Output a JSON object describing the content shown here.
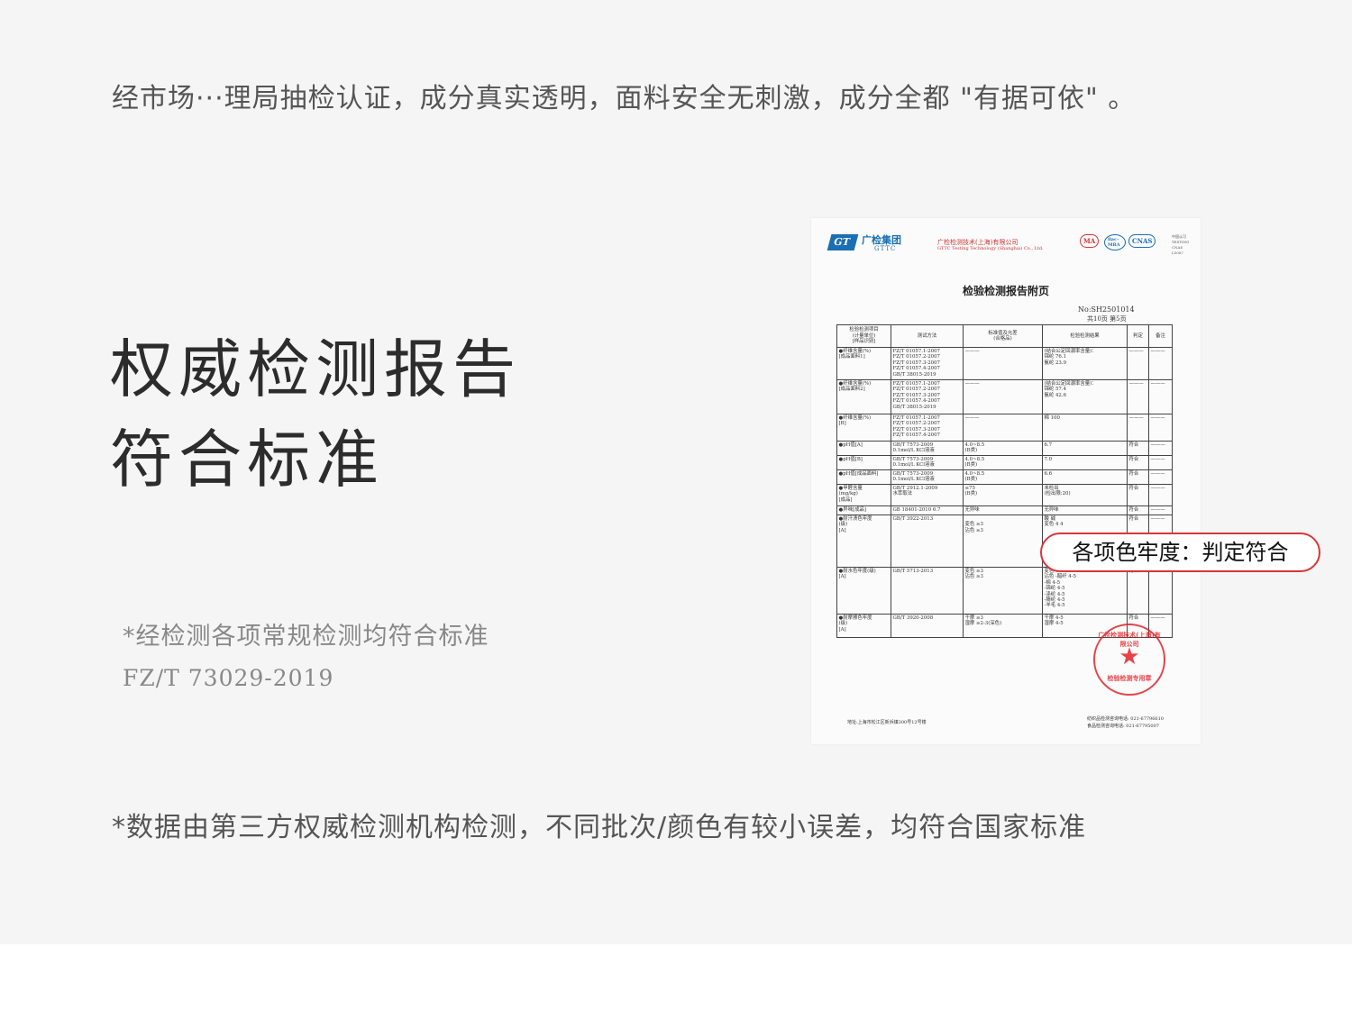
{
  "top_text": "经市场···理局抽检认证，成分真实透明，面料安全无刺激，成分全都 \"有据可依\" 。",
  "headline": {
    "line1": "权威检测报告",
    "line2": "符合标准"
  },
  "note1": "*经检测各项常规检测均符合标准",
  "note2": "FZ/T  73029-2019",
  "bottom_text": "*数据由第三方权威检测机构检测，不同批次/颜色有较小误差，均符合国家标准",
  "callout": "各项色牢度：判定符合",
  "report": {
    "group_name": "广检集团",
    "group_sub": "GTTC",
    "company": "广检检测技术(上海)有限公司",
    "company_en": "GTTC Testing Technology (Shanghai) Co., Ltd.",
    "cert_ma": "MA",
    "cert_ilac": "ilac-MRA",
    "cert_cnas": "CNAS",
    "cert_small": "中国认可\nTESTING\nCNAS L5007",
    "title": "检验检测报告附页",
    "report_no": "No:SH2501014",
    "page_info": "共10页  第5页",
    "headers": [
      "检验检测项目\n(计量单位)\n[样品识别]",
      "测试方法",
      "标准值及允差\n(合格品)",
      "检验检测结果",
      "判定",
      "备注"
    ],
    "rows": [
      [
        "●纤维含量(%)\n[成品面料1]",
        "FZ/T 01057.1-2007\nFZ/T 01057.2-2007\nFZ/T 01057.3-2007\nFZ/T 01057.4-2007\nGB/T 38015-2019",
        "———",
        "(结合公定回潮率含量)：\n锦纶        76.1\n氨纶        23.9",
        "———",
        "———"
      ],
      [
        "●纤维含量(%)\n[成品面料2]",
        "FZ/T 01057.1-2007\nFZ/T 01057.2-2007\nFZ/T 01057.3-2007\nFZ/T 01057.4-2007\nGB/T 38015-2019",
        "———",
        "(结合公定回潮率含量)：\n锦纶        57.4\n氨纶        42.6",
        "———",
        "———"
      ],
      [
        "●纤维含量(%)\n[B]",
        "FZ/T 01057.1-2007\nFZ/T 01057.2-2007\nFZ/T 01057.3-2007\nFZ/T 01057.4-2007",
        "———",
        "棉          100",
        "———",
        "———"
      ],
      [
        "●pH值[A]",
        "GB/T 7573-2009\n0.1mol/L KCl溶液",
        "4.0~8.5\n(B类)",
        "6.7",
        "符合",
        "———"
      ],
      [
        "●pH值[B]",
        "GB/T 7573-2009\n0.1mol/L KCl溶液",
        "4.0~8.5\n(B类)",
        "7.0",
        "符合",
        "———"
      ],
      [
        "●pH值[成品面料]",
        "GB/T 7573-2009\n0.1mol/L KCl溶液",
        "4.0~8.5\n(B类)",
        "6.6",
        "符合",
        "———"
      ],
      [
        "●甲醛含量\n(mg/kg)\n[成品]",
        "GB/T 2912.1-2009\n水萃取法",
        "≤75\n(B类)",
        "未检出\n(检出限:20)",
        "符合",
        "———"
      ],
      [
        "●异味[成品]",
        "GB 18401-2010 6.7",
        "无异味",
        "无异味",
        "符合",
        "———"
      ],
      [
        "●耐汗渍色牢度\n(级)\n[A]",
        "GB/T 3922-2013",
        "\n变色  ≥3\n沾色  ≥3",
        "            酸      碱\n变色       4       4",
        "符合",
        "———"
      ],
      [
        "●耐水色牢度(级)\n[A]",
        "GB/T 5713-2013",
        "变色  ≥3\n沾色  ≥3",
        "变色       4\n沾色  -醋纤  4-5\n      -棉    4-5\n      -锦纶  4-5\n      -涤纶  4-5\n      -腈纶  4-5\n      -羊毛  4-5",
        "符合",
        "———"
      ],
      [
        "●耐摩擦色牢度\n(级)\n[A]",
        "GB/T 3920-2008",
        "干摩  ≥3\n湿摩  ≥2-3(深色)",
        "干摩       4-5\n湿摩       4-5",
        "符合",
        "———"
      ]
    ],
    "stamp_ring": "广检检测技术(上海)有限公司",
    "stamp_text": "检验检测专用章",
    "footer_address": "地址:上海市松江区新浜镇300号12号楼",
    "footer_tel1": "纺织品检测咨询电话: 021-67796610",
    "footer_tel2": "食品检测咨询电话: 021-67795007"
  }
}
